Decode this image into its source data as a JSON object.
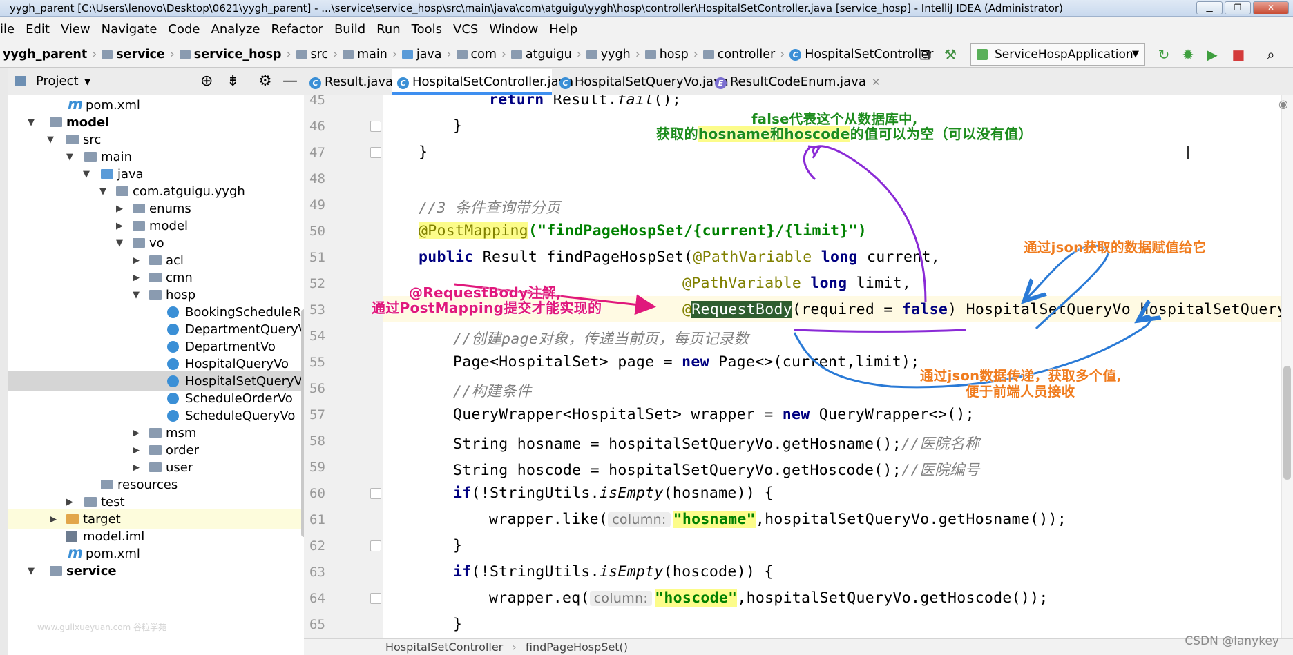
{
  "window": {
    "title": "yygh_parent [C:\\Users\\lenovo\\Desktop\\0621\\yygh_parent] - ...\\service\\service_hosp\\src\\main\\java\\com\\atguigu\\yygh\\hosp\\controller\\HospitalSetController.java [service_hosp] - IntelliJ IDEA (Administrator)"
  },
  "menu": [
    "ile",
    "Edit",
    "View",
    "Navigate",
    "Code",
    "Analyze",
    "Refactor",
    "Build",
    "Run",
    "Tools",
    "VCS",
    "Window",
    "Help"
  ],
  "breadcrumbs": [
    "yygh_parent",
    "service",
    "service_hosp",
    "src",
    "main",
    "java",
    "com",
    "atguigu",
    "yygh",
    "hosp",
    "controller",
    "HospitalSetController"
  ],
  "run_config": "ServiceHospApplication",
  "project_panel": {
    "title": "Project"
  },
  "tree": [
    "pom.xml",
    "model",
    "src",
    "main",
    "java",
    "com.atguigu.yygh",
    "enums",
    "model",
    "vo",
    "acl",
    "cmn",
    "hosp",
    "BookingScheduleR",
    "DepartmentQueryV",
    "DepartmentVo",
    "HospitalQueryVo",
    "HospitalSetQueryV",
    "ScheduleOrderVo",
    "ScheduleQueryVo",
    "msm",
    "order",
    "user",
    "resources",
    "test",
    "target",
    "model.iml",
    "pom.xml",
    "service"
  ],
  "tabs": [
    {
      "label": "Result.java"
    },
    {
      "label": "HospitalSetController.java"
    },
    {
      "label": "HospitalSetQueryVo.java"
    },
    {
      "label": "ResultCodeEnum.java"
    }
  ],
  "line_numbers": [
    "45",
    "46",
    "47",
    "48",
    "49",
    "50",
    "51",
    "52",
    "53",
    "54",
    "55",
    "56",
    "57",
    "58",
    "59",
    "60",
    "61",
    "62",
    "63",
    "64",
    "65"
  ],
  "code": {
    "l45": {
      "kw": "return",
      "rest": " Result.",
      "it": "fail",
      "tail": "();"
    },
    "l46": "}",
    "l47": "}",
    "l49": "//3 条件查询带分页",
    "l50": {
      "ann": "@PostMapping",
      "str": "(\"findPageHospSet/{current}/{limit}\")"
    },
    "l51": {
      "k1": "public",
      "mid": " Result findPageHospSet(",
      "ann": "@PathVariable",
      "k2": " long",
      "tail": " current,"
    },
    "l52": {
      "ann": "@PathVariable",
      "k": " long",
      "tail": " limit,"
    },
    "l53": {
      "at": "@",
      "ann": "RequestBody",
      "p1": "(required = ",
      "kw": "false",
      "tail": ") HospitalSetQueryVo hospitalSetQueryVo)"
    },
    "l54": "//创建page对象，传递当前页，每页记录数",
    "l55": {
      "a": "Page<HospitalSet> page = ",
      "kw": "new",
      "b": " Page<>(current,limit);"
    },
    "l56": "//构建条件",
    "l57": {
      "a": "QueryWrapper<HospitalSet> wrapper = ",
      "kw": "new",
      "b": " QueryWrapper<>();"
    },
    "l58": {
      "a": "String hosname = hospitalSetQueryVo.getHosname();",
      "c": "//医院名称"
    },
    "l59": {
      "a": "String hoscode = hospitalSetQueryVo.getHoscode();",
      "c": "//医院编号"
    },
    "l60": {
      "kw": "if",
      "a": "(!StringUtils.",
      "it": "isEmpty",
      "b": "(hosname)) {"
    },
    "l61": {
      "a": "wrapper.like(",
      "hint": "column:",
      "str": "\"hosname\"",
      "b": ",hospitalSetQueryVo.getHosname());"
    },
    "l62": "}",
    "l63": {
      "kw": "if",
      "a": "(!StringUtils.",
      "it": "isEmpty",
      "b": "(hoscode)) {"
    },
    "l64": {
      "a": "wrapper.eq(",
      "hint": "column:",
      "str": "\"hoscode\"",
      "b": ",hospitalSetQueryVo.getHoscode());"
    },
    "l65": "}"
  },
  "status": {
    "crumb1": "HospitalSetController",
    "crumb2": "findPageHospSet()"
  },
  "annotations": {
    "purple1": "false代表这个从数据库中,",
    "purple2a": "获取的",
    "purple2b": "hosname和hoscode",
    "purple2c": "的值可以为空（可以没有值）",
    "pink1": "@RequestBody注解,",
    "pink2": "通过PostMapping提交才能实现的",
    "orange1": "通过json获取的数据赋值给它",
    "orange2": "通过json数据传递，获取多个值,",
    "orange3": "便于前端人员接收"
  },
  "watermark": "CSDN @lanykey",
  "faint_watermark": "www.gulixueyuan.com 谷粒学苑"
}
